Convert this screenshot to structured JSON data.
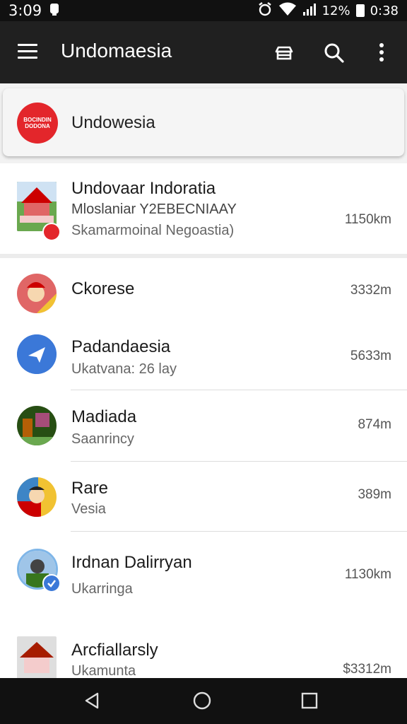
{
  "status_bar": {
    "time_left": "3:09",
    "battery_percent": "12%",
    "time_right": "0:38"
  },
  "app_bar": {
    "title": "Undomaesia",
    "icons": [
      "menu-icon",
      "store-icon",
      "search-icon",
      "more-vert-icon"
    ]
  },
  "selected_country": {
    "flag_text_1": "BOCINDIN",
    "flag_text_2": "DODONA",
    "name": "Undowesia"
  },
  "items": [
    {
      "title": "Undovaar Indoratia",
      "subtitle": "Mloslaniar Y2EBECNIAAY",
      "subtitle2": "Skamarmoinal Negoastia)",
      "distance": "1150km",
      "icon": "pavilion-thumbnail"
    },
    {
      "title": "Ckorese",
      "subtitle": "",
      "distance": "3332m",
      "icon": "portrait-avatar"
    },
    {
      "title": "Padandaesia",
      "subtitle": "Ukatvana: 26 lay",
      "distance": "5633m",
      "icon": "navigation-icon"
    },
    {
      "title": "Madiada",
      "subtitle": "Saanrincy",
      "distance": "874m",
      "icon": "landscape-avatar"
    },
    {
      "title": "Rare",
      "subtitle": "Vesia",
      "distance": "389m",
      "icon": "flag-portrait-avatar"
    },
    {
      "title": "Irdnan Dalirryan",
      "subtitle": "Ukarringa",
      "distance": "1130km",
      "icon": "verified-avatar"
    },
    {
      "title": "Arcfiallarsly",
      "subtitle": "Ukamunta",
      "distance": "$3312m",
      "icon": "building-thumbnail"
    }
  ],
  "colors": {
    "app_bar": "#202020",
    "status_bar": "#111111",
    "flag_red": "#e3262b",
    "nav_blue": "#3b78d8",
    "accent_yellow": "#f2c200"
  }
}
